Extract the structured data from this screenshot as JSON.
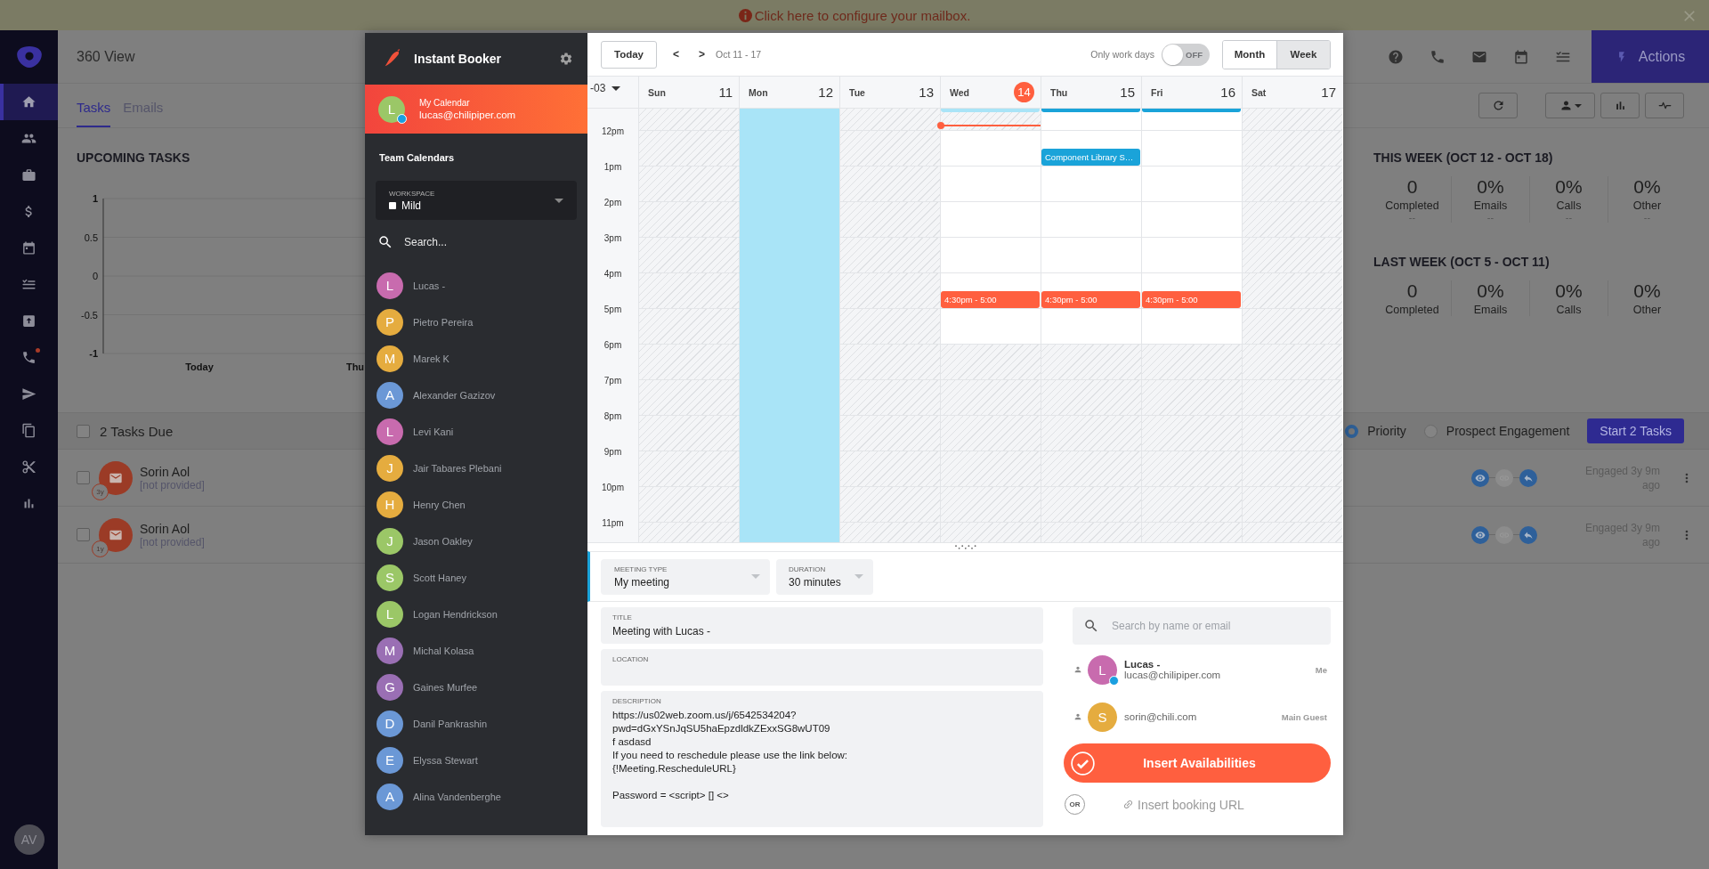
{
  "banner": {
    "text": "Click here to configure your mailbox."
  },
  "nav": {
    "items": [
      {
        "kind": "home",
        "selected": true,
        "badge": false
      },
      {
        "kind": "people",
        "selected": false,
        "badge": false
      },
      {
        "kind": "briefcase",
        "selected": false,
        "badge": false
      },
      {
        "kind": "dollar",
        "selected": false,
        "badge": false
      },
      {
        "kind": "calendar",
        "selected": false,
        "badge": false
      },
      {
        "kind": "tasks",
        "selected": false,
        "badge": false
      },
      {
        "kind": "upload",
        "selected": false,
        "badge": false
      },
      {
        "kind": "phone",
        "selected": false,
        "badge": true
      },
      {
        "kind": "send",
        "selected": false,
        "badge": false
      },
      {
        "kind": "copy",
        "selected": false,
        "badge": false
      },
      {
        "kind": "scissors",
        "selected": false,
        "badge": false
      },
      {
        "kind": "bar-chart",
        "selected": false,
        "badge": false
      }
    ],
    "avatar": "AV"
  },
  "header": {
    "title": "360 View",
    "tools": [
      {
        "kind": "help"
      },
      {
        "kind": "phone"
      },
      {
        "kind": "mail"
      },
      {
        "kind": "calendar"
      },
      {
        "kind": "tasks"
      }
    ],
    "actions_label": "Actions"
  },
  "tabs": [
    {
      "label": "Tasks",
      "selected": true
    },
    {
      "label": "Emails",
      "selected": false
    }
  ],
  "toolbar": [
    {
      "kind": "refresh"
    },
    {
      "kind": "person"
    },
    {
      "kind": "bar-chart"
    },
    {
      "kind": "pulse"
    }
  ],
  "upcoming": {
    "title": "UPCOMING TASKS",
    "chart_data": {
      "type": "line",
      "categories": [
        "Today",
        "Thu"
      ],
      "ylim": [
        -1,
        1
      ],
      "grid": true,
      "yticks": [
        1,
        0.5,
        0,
        -0.5,
        -1
      ]
    }
  },
  "this_week": {
    "title": "THIS WEEK (OCT 12 - OCT 18)",
    "stats": [
      {
        "value": "0",
        "label": "Completed",
        "sub": "--"
      },
      {
        "value": "0%",
        "label": "Emails",
        "sub": "--"
      },
      {
        "value": "0%",
        "label": "Calls",
        "sub": "--"
      },
      {
        "value": "0%",
        "label": "Other",
        "sub": "--"
      }
    ]
  },
  "last_week": {
    "title": "LAST WEEK (OCT 5 - OCT 11)",
    "stats": [
      {
        "value": "0",
        "label": "Completed"
      },
      {
        "value": "0%",
        "label": "Emails"
      },
      {
        "value": "0%",
        "label": "Calls"
      },
      {
        "value": "0%",
        "label": "Other"
      }
    ]
  },
  "tasks_bar": {
    "checked": false,
    "label": "2 Tasks Due",
    "sort_options": [
      {
        "label": "Priority",
        "selected": true
      },
      {
        "label": "Prospect Engagement",
        "selected": false
      }
    ],
    "start_label": "Start 2 Tasks"
  },
  "tasks": [
    {
      "checked": false,
      "name": "Sorin Aol",
      "detail": "[not provided]",
      "age": "3y",
      "steps": [
        {
          "kind": "view",
          "done": true
        },
        {
          "kind": "link",
          "done": false
        },
        {
          "kind": "reply",
          "done": true
        }
      ],
      "engaged": "Engaged 3y 9m ago"
    },
    {
      "checked": false,
      "name": "Sorin Aol",
      "detail": "[not provided]",
      "age": "1y",
      "steps": [
        {
          "kind": "view",
          "done": true
        },
        {
          "kind": "link",
          "done": false
        },
        {
          "kind": "reply",
          "done": true
        }
      ],
      "engaged": "Engaged 3y 9m ago"
    }
  ],
  "booker": {
    "title": "Instant Booker",
    "my_calendar": {
      "initial": "L",
      "online": true,
      "label": "My Calendar",
      "email": "lucas@chilipiper.com"
    },
    "team_title": "Team Calendars",
    "workspace": {
      "label": "WORKSPACE",
      "value": "Mild",
      "checked": false
    },
    "search_placeholder": "Search...",
    "people": [
      {
        "initial": "L",
        "name": "Lucas -",
        "color": "#c86bae"
      },
      {
        "initial": "P",
        "name": "Pietro Pereira",
        "color": "#e5ac3f"
      },
      {
        "initial": "M",
        "name": "Marek K",
        "color": "#e5ac3f"
      },
      {
        "initial": "A",
        "name": "Alexander Gazizov",
        "color": "#6b98d6"
      },
      {
        "initial": "L",
        "name": "Levi Kani",
        "color": "#c86bae"
      },
      {
        "initial": "J",
        "name": "Jair Tabares Plebani",
        "color": "#e5ac3f"
      },
      {
        "initial": "H",
        "name": "Henry Chen",
        "color": "#e5ac3f"
      },
      {
        "initial": "J",
        "name": "Jason Oakley",
        "color": "#9bc767"
      },
      {
        "initial": "S",
        "name": "Scott Haney",
        "color": "#9bc767"
      },
      {
        "initial": "L",
        "name": "Logan Hendrickson",
        "color": "#9bc767"
      },
      {
        "initial": "M",
        "name": "Michal Kolasa",
        "color": "#9a6fb4"
      },
      {
        "initial": "G",
        "name": "Gaines Murfee",
        "color": "#9a6fb4"
      },
      {
        "initial": "D",
        "name": "Danil Pankrashin",
        "color": "#6b98d6"
      },
      {
        "initial": "E",
        "name": "Elyssa Stewart",
        "color": "#6b98d6"
      },
      {
        "initial": "A",
        "name": "Alina Vandenberghe",
        "color": "#6b98d6"
      }
    ]
  },
  "calendar": {
    "today_label": "Today",
    "prev": "<",
    "next": ">",
    "range": "Oct 11 - 17",
    "work_days": {
      "label": "Only work days",
      "on": false,
      "state_label": "OFF"
    },
    "views": [
      {
        "label": "Month",
        "selected": false
      },
      {
        "label": "Week",
        "selected": true
      }
    ],
    "timezone": "-03",
    "days": [
      {
        "name": "Sun",
        "number": "11",
        "today": false,
        "now_line": false
      },
      {
        "name": "Mon",
        "number": "12",
        "today": false,
        "now_line": false
      },
      {
        "name": "Tue",
        "number": "13",
        "today": false,
        "now_line": false
      },
      {
        "name": "Wed",
        "number": "14",
        "today": true,
        "now_line": true
      },
      {
        "name": "Thu",
        "number": "15",
        "today": false,
        "now_line": false
      },
      {
        "name": "Fri",
        "number": "16",
        "today": false,
        "now_line": false
      },
      {
        "name": "Sat",
        "number": "17",
        "today": false,
        "now_line": false
      }
    ],
    "rows": [
      {
        "cells": [
          {
            "kind": "hatched"
          },
          {
            "kind": "blue"
          },
          {
            "kind": "hatched"
          },
          {
            "kind": "hatched",
            "events": [
              {
                "kind": "continued",
                "color": "#a9e4f7"
              }
            ]
          },
          {
            "kind": "open",
            "events": [
              {
                "kind": "continued",
                "color": "#1aa3d9"
              }
            ]
          },
          {
            "kind": "open",
            "events": [
              {
                "kind": "continued",
                "color": "#1aa3d9"
              }
            ]
          },
          {
            "kind": "hatched"
          }
        ]
      },
      {
        "label": "12pm",
        "cells": [
          {
            "kind": "hatched"
          },
          {
            "kind": "blue"
          },
          {
            "kind": "hatched"
          },
          {
            "kind": "open"
          },
          {
            "kind": "open",
            "events": [
              {
                "kind": "timed",
                "half_past": true,
                "label": "Component Library S…",
                "color": "#1aa3d9"
              }
            ]
          },
          {
            "kind": "open"
          },
          {
            "kind": "hatched"
          }
        ]
      },
      {
        "label": "1pm",
        "cells": [
          {
            "kind": "hatched"
          },
          {
            "kind": "blue"
          },
          {
            "kind": "hatched"
          },
          {
            "kind": "open"
          },
          {
            "kind": "open"
          },
          {
            "kind": "open"
          },
          {
            "kind": "hatched"
          }
        ]
      },
      {
        "label": "2pm",
        "cells": [
          {
            "kind": "hatched"
          },
          {
            "kind": "blue"
          },
          {
            "kind": "hatched"
          },
          {
            "kind": "open"
          },
          {
            "kind": "open"
          },
          {
            "kind": "open"
          },
          {
            "kind": "hatched"
          }
        ]
      },
      {
        "label": "3pm",
        "cells": [
          {
            "kind": "hatched"
          },
          {
            "kind": "blue"
          },
          {
            "kind": "hatched"
          },
          {
            "kind": "open"
          },
          {
            "kind": "open"
          },
          {
            "kind": "open"
          },
          {
            "kind": "hatched"
          }
        ]
      },
      {
        "label": "4pm",
        "cells": [
          {
            "kind": "hatched"
          },
          {
            "kind": "blue"
          },
          {
            "kind": "hatched"
          },
          {
            "kind": "open",
            "events": [
              {
                "kind": "timed",
                "half_past": true,
                "label": "4:30pm - 5:00",
                "color": "#ff5f3f"
              }
            ]
          },
          {
            "kind": "open",
            "events": [
              {
                "kind": "timed",
                "half_past": true,
                "label": "4:30pm - 5:00",
                "color": "#ff5f3f"
              }
            ]
          },
          {
            "kind": "open",
            "events": [
              {
                "kind": "timed",
                "half_past": true,
                "label": "4:30pm - 5:00",
                "color": "#ff5f3f"
              }
            ]
          },
          {
            "kind": "hatched"
          }
        ]
      },
      {
        "label": "5pm",
        "cells": [
          {
            "kind": "hatched"
          },
          {
            "kind": "blue"
          },
          {
            "kind": "hatched"
          },
          {
            "kind": "open"
          },
          {
            "kind": "open"
          },
          {
            "kind": "open"
          },
          {
            "kind": "hatched"
          }
        ]
      },
      {
        "label": "6pm",
        "cells": [
          {
            "kind": "hatched"
          },
          {
            "kind": "blue"
          },
          {
            "kind": "hatched"
          },
          {
            "kind": "hatched"
          },
          {
            "kind": "hatched"
          },
          {
            "kind": "hatched"
          },
          {
            "kind": "hatched"
          }
        ]
      },
      {
        "label": "7pm",
        "cells": [
          {
            "kind": "hatched"
          },
          {
            "kind": "blue"
          },
          {
            "kind": "hatched"
          },
          {
            "kind": "hatched"
          },
          {
            "kind": "hatched"
          },
          {
            "kind": "hatched"
          },
          {
            "kind": "hatched"
          }
        ]
      },
      {
        "label": "8pm",
        "cells": [
          {
            "kind": "hatched"
          },
          {
            "kind": "blue"
          },
          {
            "kind": "hatched"
          },
          {
            "kind": "hatched"
          },
          {
            "kind": "hatched"
          },
          {
            "kind": "hatched"
          },
          {
            "kind": "hatched"
          }
        ]
      },
      {
        "label": "9pm",
        "cells": [
          {
            "kind": "hatched"
          },
          {
            "kind": "blue"
          },
          {
            "kind": "hatched"
          },
          {
            "kind": "hatched"
          },
          {
            "kind": "hatched"
          },
          {
            "kind": "hatched"
          },
          {
            "kind": "hatched"
          }
        ]
      },
      {
        "label": "10pm",
        "cells": [
          {
            "kind": "hatched"
          },
          {
            "kind": "blue"
          },
          {
            "kind": "hatched"
          },
          {
            "kind": "hatched"
          },
          {
            "kind": "hatched"
          },
          {
            "kind": "hatched"
          },
          {
            "kind": "hatched"
          }
        ]
      },
      {
        "label": "11pm",
        "cells": [
          {
            "kind": "hatched"
          },
          {
            "kind": "blue"
          },
          {
            "kind": "hatched"
          },
          {
            "kind": "hatched"
          },
          {
            "kind": "hatched"
          },
          {
            "kind": "hatched"
          },
          {
            "kind": "hatched"
          }
        ]
      }
    ]
  },
  "meeting": {
    "selects": [
      {
        "label": "MEETING TYPE",
        "value": "My meeting"
      },
      {
        "label": "DURATION",
        "value": "30 minutes"
      }
    ],
    "title": {
      "label": "TITLE",
      "value": "Meeting with Lucas -"
    },
    "location": {
      "label": "LOCATION"
    },
    "description": {
      "label": "DESCRIPTION",
      "value": "https://us02web.zoom.us/j/6542534204?\npwd=dGxYSnJqSU5haEpzdldkZExxSG8wUT09\nf asdasd\nIf you need to reschedule please use the link below:\n{!Meeting.RescheduleURL}\n\nPassword = <script> [] <>"
    }
  },
  "guests": {
    "search_placeholder": "Search by name or email",
    "people": [
      {
        "initial": "L",
        "name": "Lucas -",
        "email": "lucas@chilipiper.com",
        "role": "Me",
        "color": "#c86bae",
        "online": true
      },
      {
        "initial": "S",
        "email": "sorin@chili.com",
        "role": "Main Guest",
        "color": "#e5ac3f",
        "online": false
      }
    ]
  },
  "insert_label": "Insert Availabilities",
  "or_label": "OR",
  "url_label": "Insert booking URL"
}
